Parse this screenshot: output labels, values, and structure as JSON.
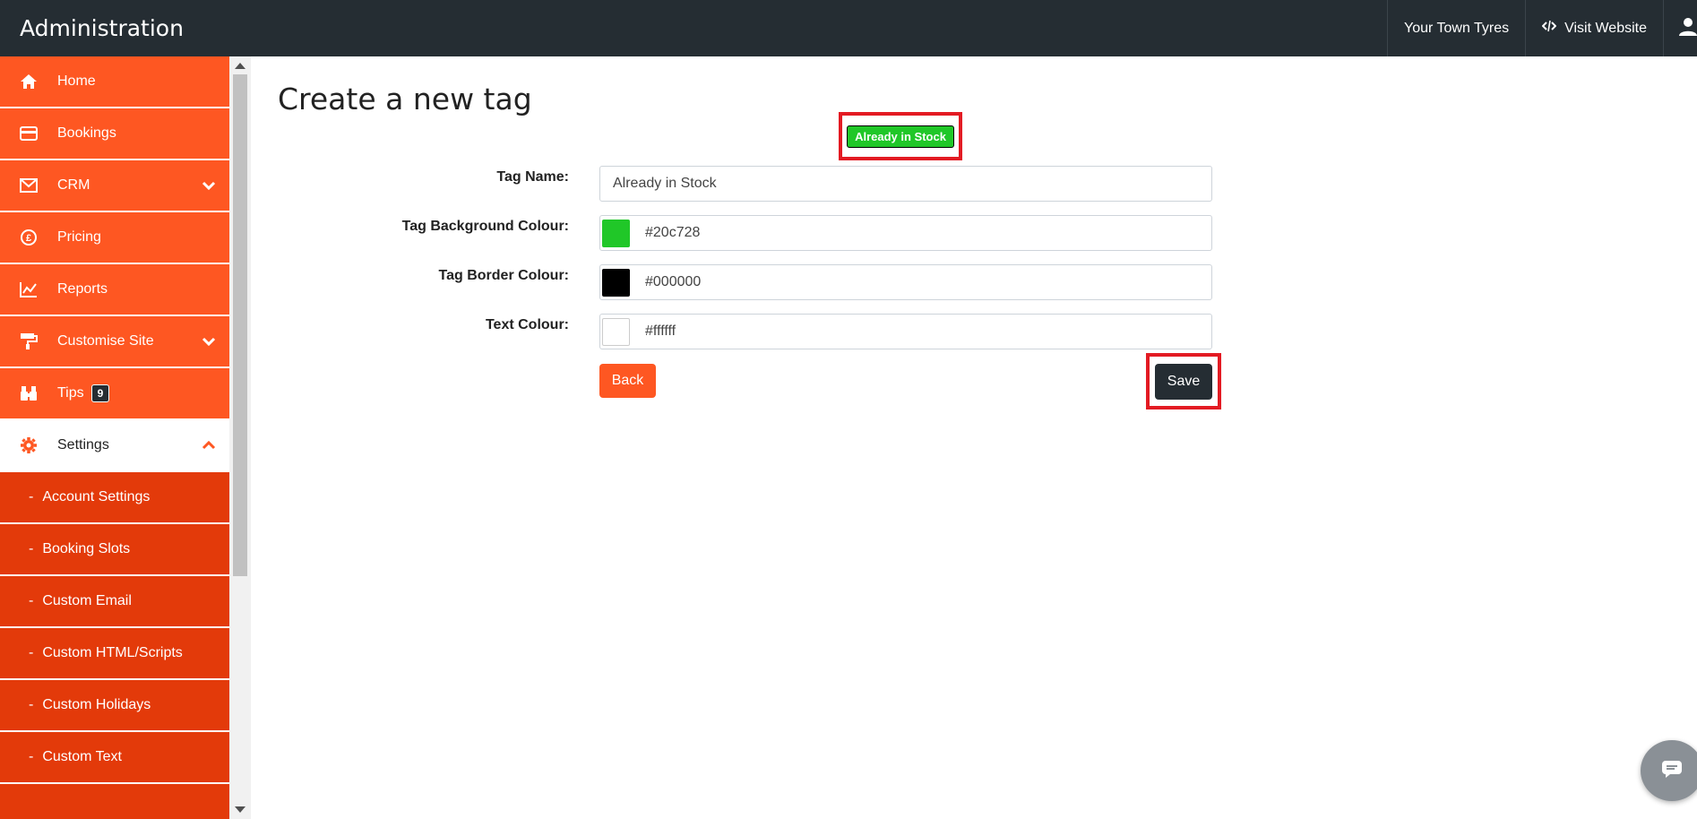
{
  "app": {
    "title": "Administration"
  },
  "topnav": {
    "site_name": "Your Town Tyres",
    "visit_label": "Visit Website"
  },
  "sidebar": {
    "items": [
      {
        "label": "Home",
        "icon": "home-icon"
      },
      {
        "label": "Bookings",
        "icon": "credit-card-icon"
      },
      {
        "label": "CRM",
        "icon": "envelope-icon"
      },
      {
        "label": "Pricing",
        "icon": "pound-circle-icon"
      },
      {
        "label": "Reports",
        "icon": "chart-line-icon"
      },
      {
        "label": "Customise Site",
        "icon": "paint-roller-icon"
      },
      {
        "label": "Tips",
        "icon": "binoculars-icon",
        "badge": "9"
      },
      {
        "label": "Settings",
        "icon": "gear-icon"
      }
    ],
    "sub_items": [
      {
        "label": "Account Settings"
      },
      {
        "label": "Booking Slots"
      },
      {
        "label": "Custom Email"
      },
      {
        "label": "Custom HTML/Scripts"
      },
      {
        "label": "Custom Holidays"
      },
      {
        "label": "Custom Text"
      }
    ],
    "sub_prefix": "-"
  },
  "page": {
    "title": "Create a new tag"
  },
  "preview": {
    "text": "Already in Stock"
  },
  "form": {
    "tag_name_label": "Tag Name:",
    "tag_name_value": "Already in Stock",
    "bg_label": "Tag Background Colour:",
    "bg_value": "#20c728",
    "border_label": "Tag Border Colour:",
    "border_value": "#000000",
    "text_label": "Text Colour:",
    "text_value": "#ffffff"
  },
  "buttons": {
    "back": "Back",
    "save": "Save"
  },
  "colors": {
    "accent": "#fe5722",
    "submenu": "#e33a0a",
    "dark": "#252d33",
    "highlight": "#e31b23"
  }
}
